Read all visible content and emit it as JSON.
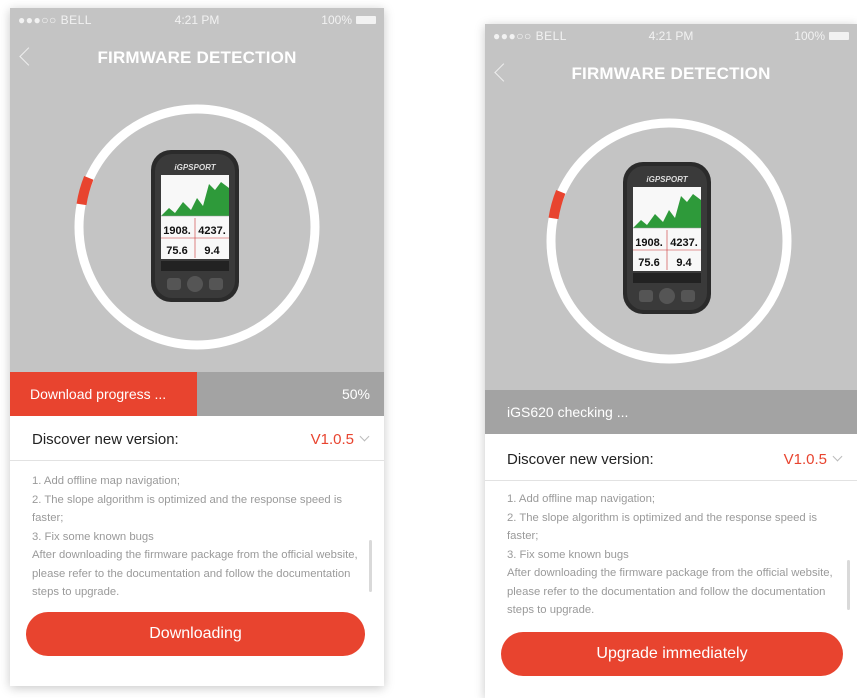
{
  "colors": {
    "accent": "#e8442f",
    "header_bg": "#c4c4c4",
    "progress_bg": "#a3a3a3",
    "note_text": "#9a9a9a"
  },
  "status_bar": {
    "carrier": "●●●○○ BELL",
    "time": "4:21 PM",
    "battery": "100%"
  },
  "header": {
    "title": "FIRMWARE DETECTION",
    "back_icon": "chevron-left-icon"
  },
  "device": {
    "brand": "iGPSPORT",
    "readings": [
      "1908.",
      "4237.",
      "75.6",
      "9.4"
    ]
  },
  "screens": [
    {
      "progress": {
        "label": "Download progress ...",
        "percent_text": "50%",
        "value": 0.5
      },
      "version": {
        "label": "Discover new version:",
        "value": "V1.0.5"
      },
      "notes": [
        "1. Add offline map navigation;",
        "2. The slope algorithm is optimized and the response speed is faster;",
        "3. Fix some known bugs",
        "After downloading the firmware package from the official website, please refer to the documentation and follow the documentation steps to upgrade."
      ],
      "button": {
        "label": "Downloading"
      }
    },
    {
      "progress": {
        "label": "iGS620 checking ...",
        "percent_text": "",
        "value": 0
      },
      "version": {
        "label": "Discover new version:",
        "value": "V1.0.5"
      },
      "notes": [
        "1. Add offline map navigation;",
        "2. The slope algorithm is optimized and the response speed is faster;",
        "3. Fix some known bugs",
        "After downloading the firmware package from the official website, please refer to the documentation and follow the documentation steps to upgrade."
      ],
      "button": {
        "label": "Upgrade immediately"
      }
    }
  ]
}
